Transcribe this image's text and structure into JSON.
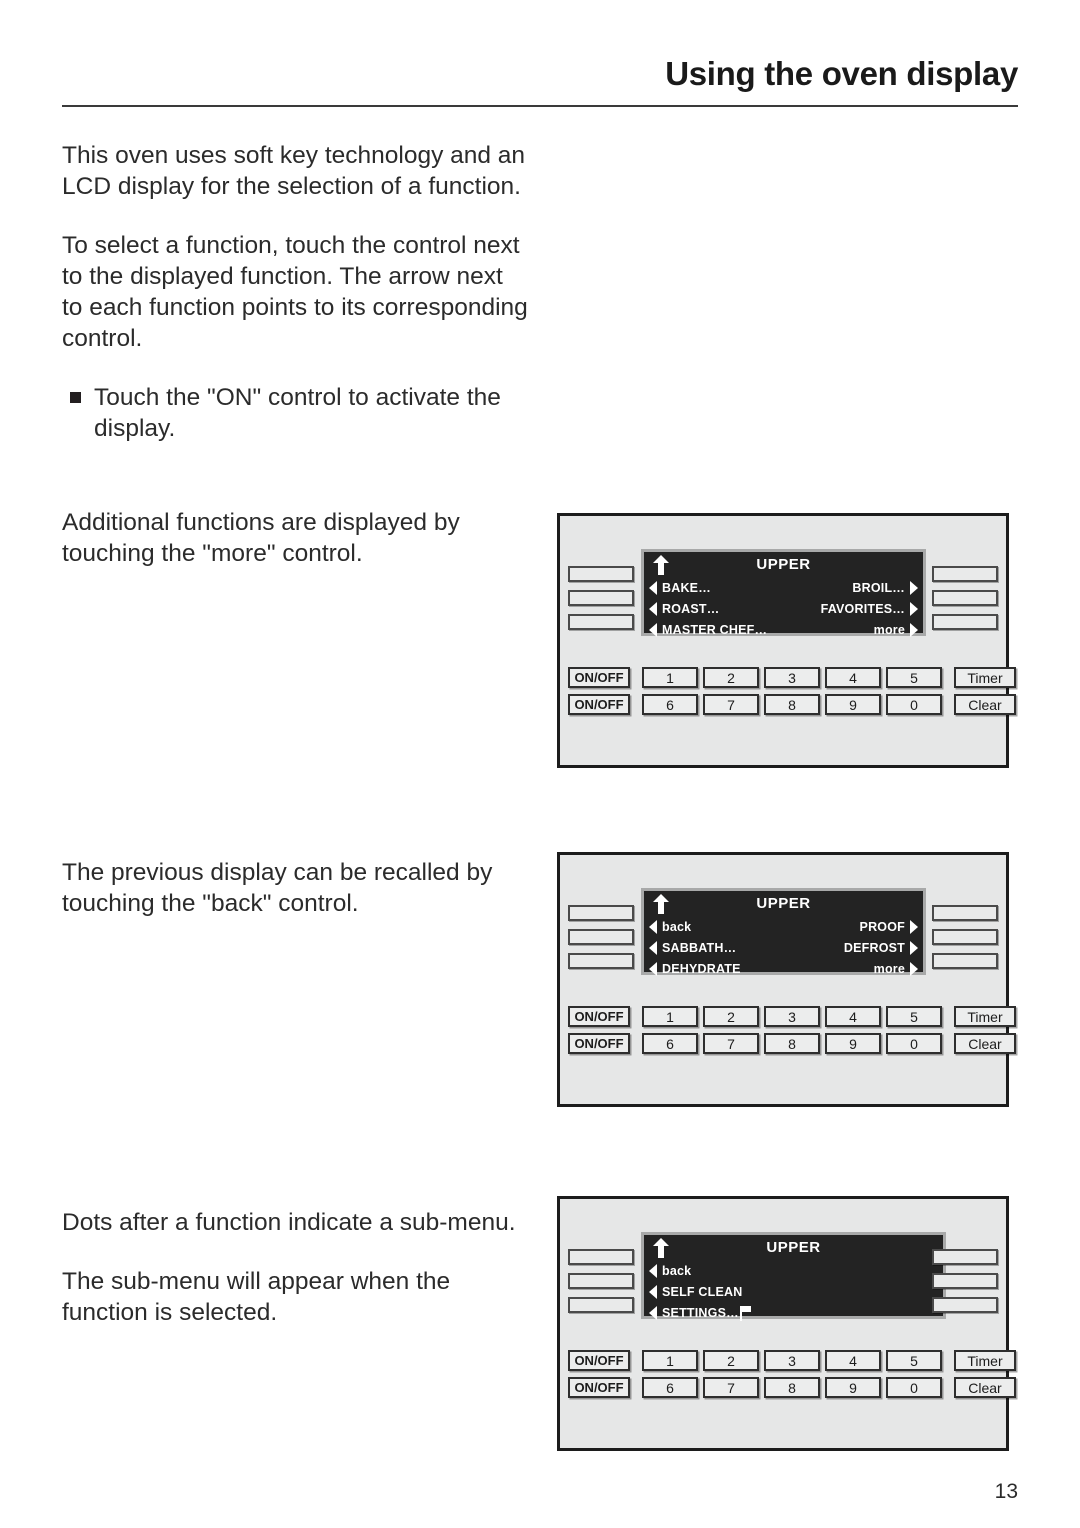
{
  "header": {
    "title": "Using the oven display"
  },
  "body": {
    "paragraph_1": "This oven uses soft key technology and an LCD display for the selection of a function.",
    "paragraph_2": "To select a function, touch the control next to the displayed function. The arrow next to each function points to its corresponding control.",
    "bullet_1": "Touch the \"ON\" control to activate the display.",
    "paragraph_3": "Additional functions are displayed by touching the \"more\" control.",
    "paragraph_4": "The previous display can be recalled by touching the \"back\" control.",
    "paragraph_5": "Dots after a function indicate a sub-menu.",
    "paragraph_6": "The sub-menu will appear when the function is selected."
  },
  "panels": [
    {
      "id": "panel-main-menu",
      "lcd": {
        "title": "UPPER",
        "up_arrow_icon": "arrow-up-icon",
        "rows": [
          {
            "left": "BAKE…",
            "right": "BROIL…"
          },
          {
            "left": "ROAST…",
            "right": "FAVORITES…"
          },
          {
            "left": "MASTER CHEF…",
            "right": "more"
          }
        ]
      },
      "keypad": {
        "onoff_labels": [
          "ON/OFF",
          "ON/OFF"
        ],
        "numbers_row_1": [
          "1",
          "2",
          "3",
          "4",
          "5"
        ],
        "numbers_row_2": [
          "6",
          "7",
          "8",
          "9",
          "0"
        ],
        "side_labels": [
          "Timer",
          "Clear"
        ]
      }
    },
    {
      "id": "panel-more-menu",
      "lcd": {
        "title": "UPPER",
        "up_arrow_icon": "arrow-up-icon",
        "rows": [
          {
            "left": "back",
            "right": "PROOF"
          },
          {
            "left": "SABBATH…",
            "right": "DEFROST"
          },
          {
            "left": "DEHYDRATE",
            "right": "more"
          }
        ]
      },
      "keypad": {
        "onoff_labels": [
          "ON/OFF",
          "ON/OFF"
        ],
        "numbers_row_1": [
          "1",
          "2",
          "3",
          "4",
          "5"
        ],
        "numbers_row_2": [
          "6",
          "7",
          "8",
          "9",
          "0"
        ],
        "side_labels": [
          "Timer",
          "Clear"
        ]
      }
    },
    {
      "id": "panel-submenu",
      "lcd": {
        "title": "UPPER",
        "up_arrow_icon": "arrow-up-icon",
        "rows": [
          {
            "left": "back",
            "right": ""
          },
          {
            "left": "SELF CLEAN",
            "right": ""
          },
          {
            "left": "SETTINGS…",
            "right": "",
            "left_icon": "flag-icon"
          }
        ]
      },
      "keypad": {
        "onoff_labels": [
          "ON/OFF",
          "ON/OFF"
        ],
        "numbers_row_1": [
          "1",
          "2",
          "3",
          "4",
          "5"
        ],
        "numbers_row_2": [
          "6",
          "7",
          "8",
          "9",
          "0"
        ],
        "side_labels": [
          "Timer",
          "Clear"
        ]
      }
    }
  ],
  "footer": {
    "page_number": "13"
  },
  "colors": {
    "lcd_background": "#232323",
    "lcd_text": "#ffffff",
    "lcd_bezel": "#a8a9a9",
    "panel_background": "#e6e7e7",
    "panel_border": "#1c1c1c",
    "page_background": "#ffffff",
    "text": "#2b2b2b"
  }
}
